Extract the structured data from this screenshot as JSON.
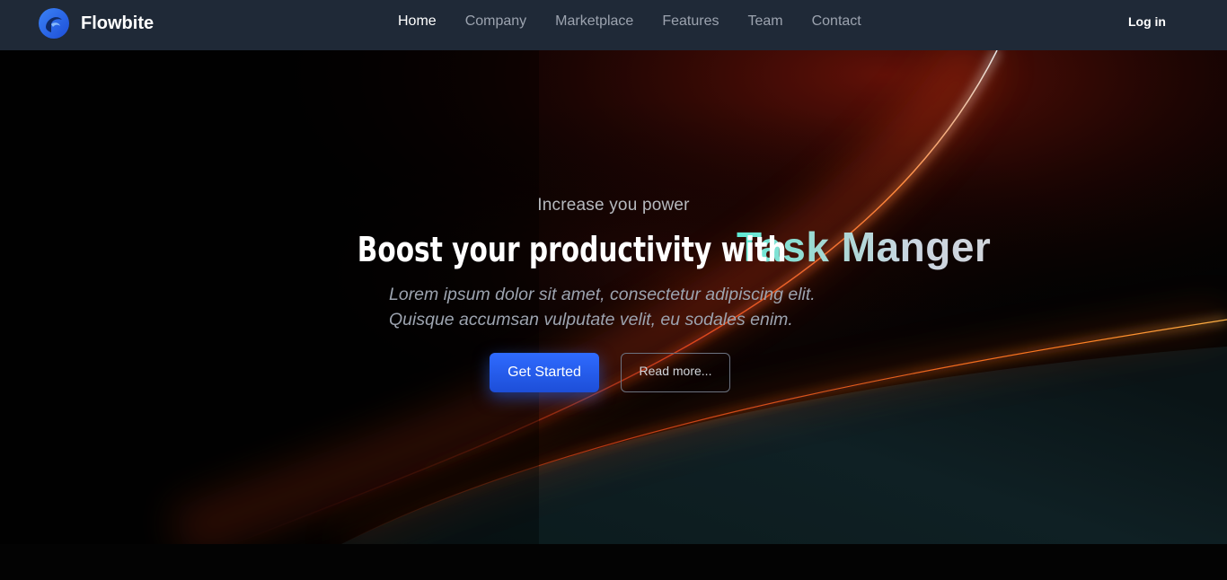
{
  "nav": {
    "brand": "Flowbite",
    "links": [
      {
        "label": "Home",
        "active": true
      },
      {
        "label": "Company",
        "active": false
      },
      {
        "label": "Marketplace",
        "active": false
      },
      {
        "label": "Features",
        "active": false
      },
      {
        "label": "Team",
        "active": false
      },
      {
        "label": "Contact",
        "active": false
      }
    ],
    "login": "Log in"
  },
  "hero": {
    "eyebrow": "Increase you power",
    "headline_lead": "Boost your productivity with",
    "headline_accent": "Task Manger",
    "description_line1": "Lorem ipsum dolor sit amet, consectetur adipiscing elit.",
    "description_line2": "Quisque accumsan vulputate velit, eu sodales enim.",
    "primary_button": "Get Started",
    "secondary_button": "Read more..."
  },
  "colors": {
    "navbar_bg": "#1f2937",
    "primary_blue": "#2563eb",
    "accent_teal": "#5eead4",
    "hero_streak": "#ea580c"
  },
  "icons": {
    "brand_logo": "flowbite-logo-icon"
  }
}
